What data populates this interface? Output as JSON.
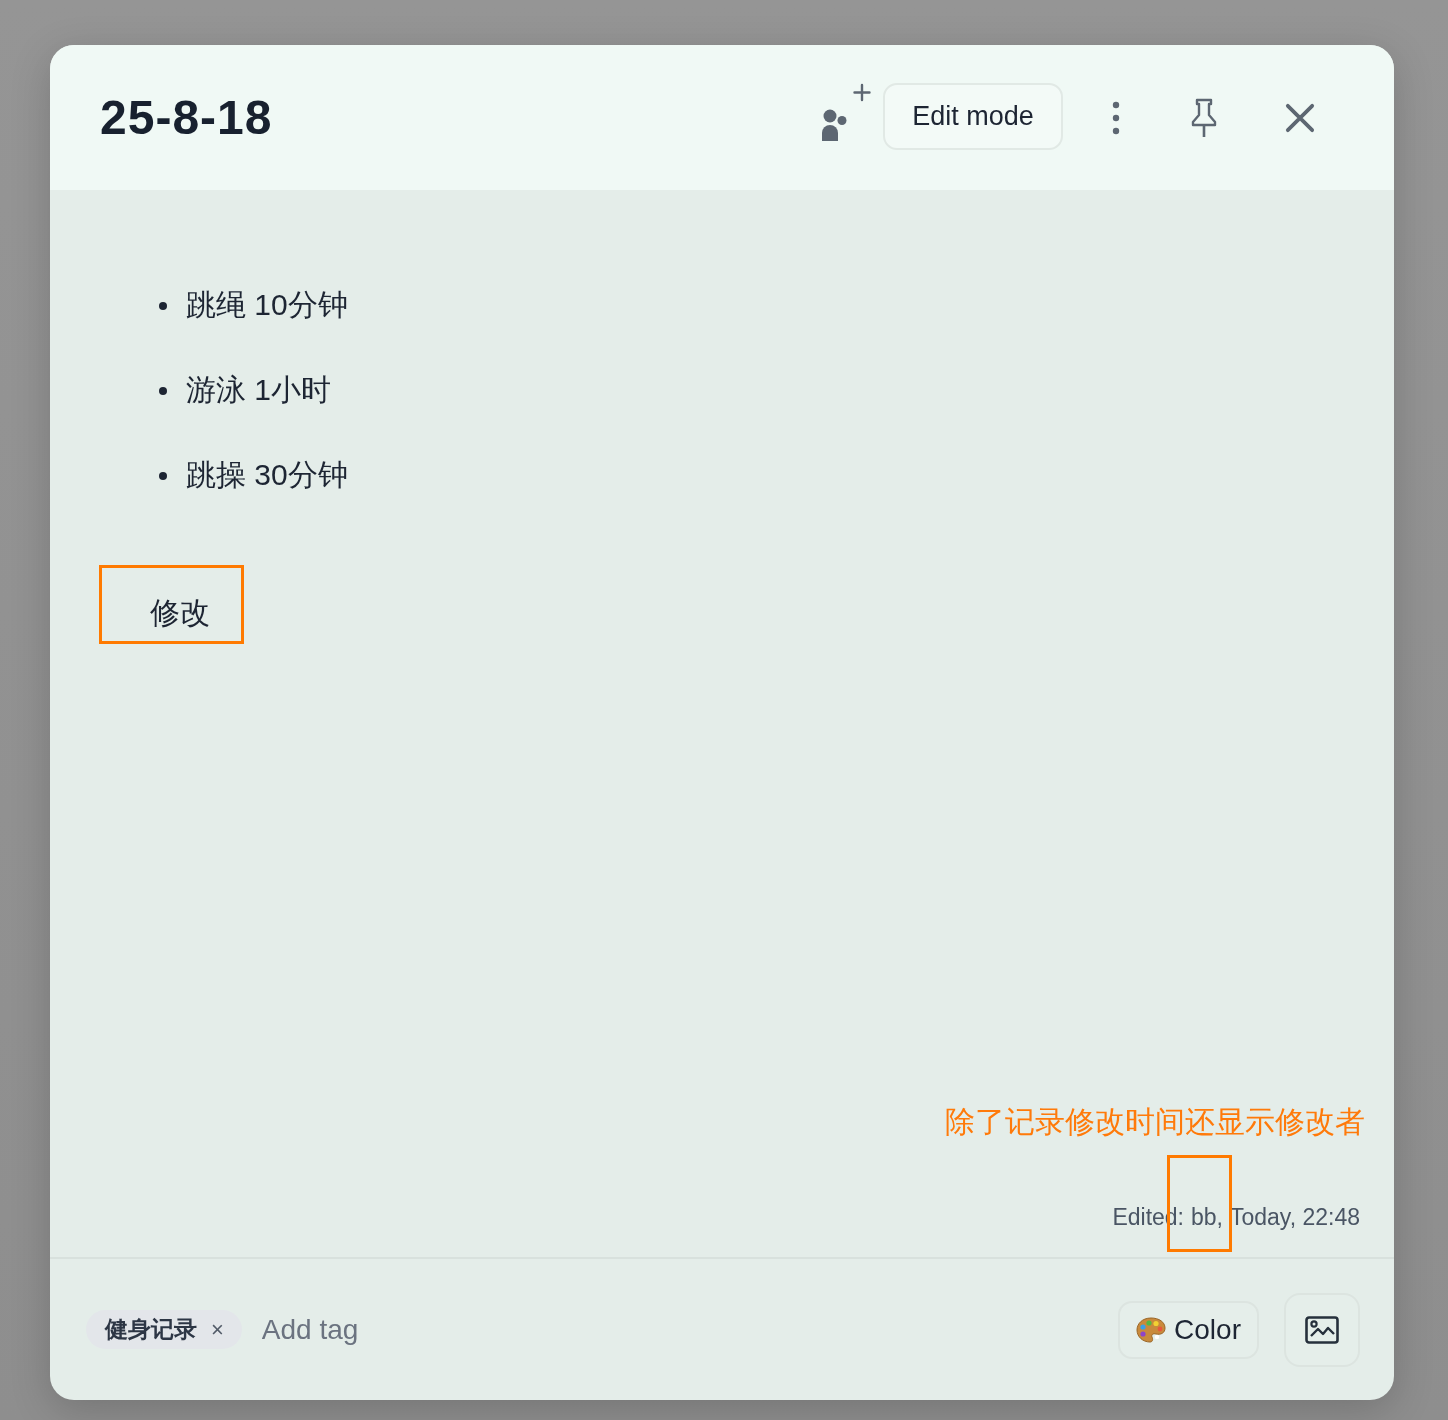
{
  "header": {
    "title": "25-8-18",
    "edit_button": "Edit mode"
  },
  "content": {
    "items": [
      "跳绳 10分钟",
      "游泳 1小时",
      "跳操 30分钟"
    ],
    "paragraph": {
      "text": "修改",
      "highlighted": true
    }
  },
  "annotation": {
    "note": "除了记录修改时间还显示修改者"
  },
  "meta": {
    "label": "Edited:",
    "author": "bb,",
    "author_highlighted": true,
    "time": "Today, 22:48"
  },
  "footer": {
    "tags": [
      {
        "label": "健身记录",
        "remove": "×"
      }
    ],
    "tag_input": {
      "placeholder": "Add tag"
    },
    "color_button": "Color"
  }
}
